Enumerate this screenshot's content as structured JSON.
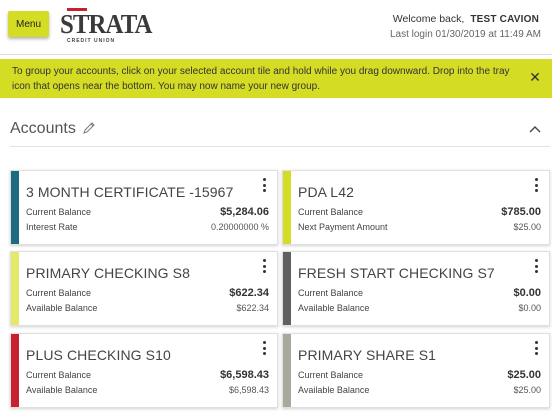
{
  "header": {
    "menu_label": "Menu",
    "logo_word": "STRATA",
    "logo_sub": "CREDIT UNION",
    "welcome_prefix": "Welcome back,",
    "user_name": "TEST CAVION",
    "last_login": "Last login 01/30/2019 at 11:49 AM"
  },
  "banner": {
    "text": "To group your accounts, click on your selected account tile and hold while you drag downward. Drop into the tray icon that opens near the bottom. You may now name your new group.",
    "close_glyph": "✕"
  },
  "accounts": {
    "title": "Accounts",
    "tiles": [
      {
        "name": "3 MONTH CERTIFICATE -15967",
        "label1": "Current Balance",
        "value1": "$5,284.06",
        "label2": "Interest Rate",
        "value2": "0.20000000 %",
        "color": "#1d6b80"
      },
      {
        "name": "PDA L42",
        "label1": "Current Balance",
        "value1": "$785.00",
        "label2": "Next Payment Amount",
        "value2": "$25.00",
        "color": "#d4dc24"
      },
      {
        "name": "PRIMARY CHECKING S8",
        "label1": "Current Balance",
        "value1": "$622.34",
        "label2": "Available Balance",
        "value2": "$622.34",
        "color": "#e3ea6a"
      },
      {
        "name": "FRESH START CHECKING S7",
        "label1": "Current Balance",
        "value1": "$0.00",
        "label2": "Available Balance",
        "value2": "$0.00",
        "color": "#5f6062"
      },
      {
        "name": "PLUS CHECKING S10",
        "label1": "Current Balance",
        "value1": "$6,598.43",
        "label2": "Available Balance",
        "value2": "$6,598.43",
        "color": "#c8202f"
      },
      {
        "name": "PRIMARY SHARE S1",
        "label1": "Current Balance",
        "value1": "$25.00",
        "label2": "Available Balance",
        "value2": "$25.00",
        "color": "#a8a89c"
      }
    ]
  }
}
